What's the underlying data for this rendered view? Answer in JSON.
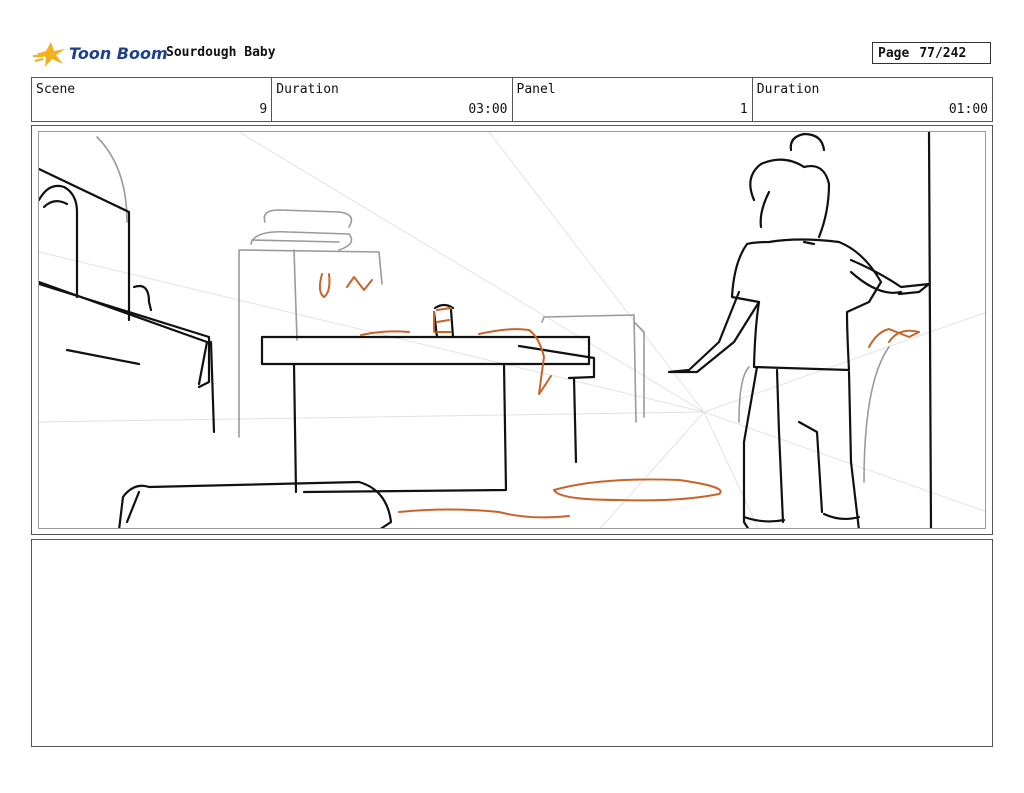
{
  "header": {
    "logo_text": "Toon Boom",
    "project_title": "Sourdough Baby",
    "page_label": "Page",
    "page_number": "77/242"
  },
  "info": {
    "scene_label": "Scene",
    "scene_value": "9",
    "scene_duration_label": "Duration",
    "scene_duration_value": "03:00",
    "panel_label": "Panel",
    "panel_value": "1",
    "panel_duration_label": "Duration",
    "panel_duration_value": "01:00"
  },
  "colors": {
    "sketch_line": "#111111",
    "sketch_gray": "#9a9a9a",
    "sketch_guides": "#e2e2e2",
    "sketch_orange": "#c8642a",
    "logo_blue": "#1f3f8f",
    "logo_yellow": "#f2b01e"
  }
}
